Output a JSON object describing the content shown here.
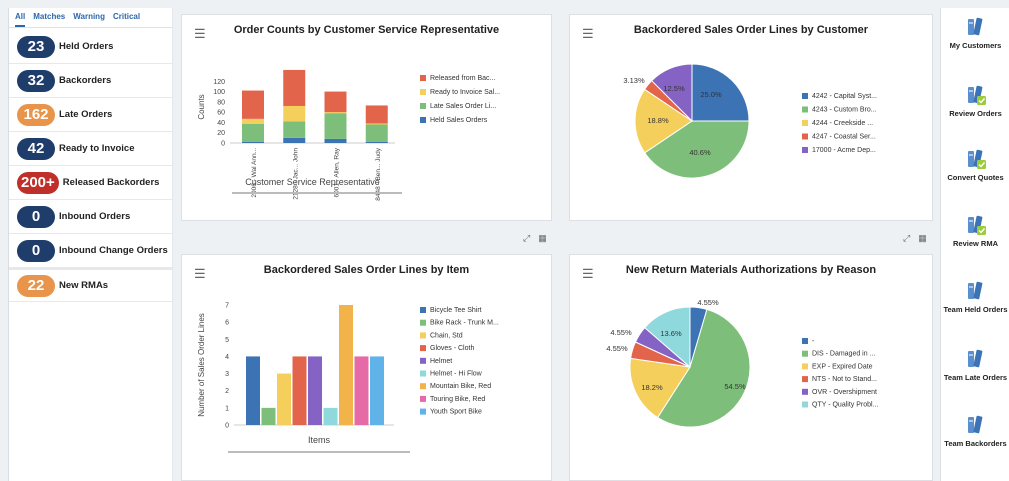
{
  "tabs": [
    "All",
    "Matches",
    "Warning",
    "Critical"
  ],
  "counters": [
    {
      "value": "23",
      "label": "Held Orders",
      "color": "#1f3d6b"
    },
    {
      "value": "32",
      "label": "Backorders",
      "color": "#1f3d6b"
    },
    {
      "value": "162",
      "label": "Late Orders",
      "color": "#e8944a"
    },
    {
      "value": "42",
      "label": "Ready to Invoice",
      "color": "#1f3d6b"
    },
    {
      "value": "200+",
      "label": "Released Backorders",
      "color": "#c0302b"
    },
    {
      "value": "0",
      "label": "Inbound Orders",
      "color": "#1f3d6b"
    },
    {
      "value": "0",
      "label": "Inbound Change Orders",
      "color": "#1f3d6b"
    },
    {
      "value": "22",
      "label": "New RMAs",
      "color": "#e8944a"
    }
  ],
  "panels": {
    "p1": {
      "title": "Order Counts by Customer Service Representative"
    },
    "p2": {
      "title": "Backordered Sales Order Lines by Customer"
    },
    "p3": {
      "title": "Backordered Sales Order Lines by Item"
    },
    "p4": {
      "title": "New Return Materials Authorizations by Reason"
    }
  },
  "chart_data": [
    {
      "type": "bar",
      "stacked": true,
      "title": "Order Counts by Customer Service Representative",
      "xlabel": "Customer Service Representative",
      "ylabel": "Counts",
      "ylim": [
        0,
        140
      ],
      "yticks": [
        0,
        20,
        40,
        60,
        80,
        100,
        120
      ],
      "categories": [
        "2006 - Wal Ann...",
        "2128 - Jac... John",
        "6001 - Allen, Ray",
        "8448 - Ben... Judy"
      ],
      "series": [
        {
          "name": "Held Sales Orders",
          "color": "#3b73b5",
          "values": [
            2,
            10,
            8,
            2
          ]
        },
        {
          "name": "Late Sales Order Li...",
          "color": "#7dbf7a",
          "values": [
            35,
            32,
            50,
            34
          ]
        },
        {
          "name": "Ready to Invoice Sal...",
          "color": "#f5cf5c",
          "values": [
            10,
            30,
            2,
            2
          ]
        },
        {
          "name": "Released from Bac...",
          "color": "#e2644a",
          "values": [
            55,
            70,
            40,
            35
          ]
        }
      ]
    },
    {
      "type": "pie",
      "title": "Backordered Sales Order Lines by Customer",
      "slices": [
        {
          "name": "4242 - Capital Syst...",
          "value": 25.0,
          "label": "25.0%",
          "color": "#3b73b5"
        },
        {
          "name": "4243 - Custom Bro...",
          "value": 40.6,
          "label": "40.6%",
          "color": "#7dbf7a"
        },
        {
          "name": "4244 - Creekside ...",
          "value": 18.8,
          "label": "18.8%",
          "color": "#f5cf5c"
        },
        {
          "name": "4247 - Coastal Ser...",
          "value": 3.13,
          "label": "3.13%",
          "color": "#e2644a"
        },
        {
          "name": "17000 - Acme Dep...",
          "value": 12.5,
          "label": "12.5%",
          "color": "#8463c4"
        }
      ]
    },
    {
      "type": "bar",
      "title": "Backordered Sales Order Lines by Item",
      "xlabel": "Items",
      "ylabel": "Number of Sales Order Lines",
      "ylim": [
        0,
        7
      ],
      "yticks": [
        0,
        1,
        2,
        3,
        4,
        5,
        6,
        7
      ],
      "categories": [
        "Bicycle Tee Shirt",
        "Bike Rack - Trunk M...",
        "Chain, Std",
        "Gloves - Cloth",
        "Helmet",
        "Helmet - Hi Flow",
        "Mountain Bike, Red",
        "Touring Bike, Red",
        "Youth Sport Bike"
      ],
      "values": [
        4,
        1,
        3,
        4,
        4,
        1,
        7,
        4,
        4
      ],
      "colors": [
        "#3b73b5",
        "#7dbf7a",
        "#f5cf5c",
        "#e2644a",
        "#8463c4",
        "#8fd8dc",
        "#f2b34b",
        "#e56aa6",
        "#5fb3e8"
      ]
    },
    {
      "type": "pie",
      "title": "New Return Materials Authorizations by Reason",
      "slices": [
        {
          "name": "-",
          "value": 4.55,
          "label": "4.55%",
          "color": "#3b73b5"
        },
        {
          "name": "DIS - Damaged in ...",
          "value": 54.5,
          "label": "54.5%",
          "color": "#7dbf7a"
        },
        {
          "name": "EXP - Expired Date",
          "value": 18.2,
          "label": "18.2%",
          "color": "#f5cf5c"
        },
        {
          "name": "NTS - Not to Stand...",
          "value": 4.55,
          "label": "4.55%",
          "color": "#e2644a"
        },
        {
          "name": "OVR - Overshipment",
          "value": 4.55,
          "label": "4.55%",
          "color": "#8463c4"
        },
        {
          "name": "QTY - Quality Probl...",
          "value": 13.6,
          "label": "13.6%",
          "color": "#8fd8dc"
        }
      ]
    }
  ],
  "rightnav": [
    {
      "label": "My Customers",
      "icon": "books-icon"
    },
    {
      "label": "Review Orders",
      "icon": "books-check-icon"
    },
    {
      "label": "Convert Quotes",
      "icon": "books-check-icon"
    },
    {
      "label": "Review RMA",
      "icon": "books-check-icon"
    },
    {
      "label": "Team Held Orders",
      "icon": "books-icon"
    },
    {
      "label": "Team Late Orders",
      "icon": "books-icon"
    },
    {
      "label": "Team Backorders",
      "icon": "books-icon"
    }
  ]
}
